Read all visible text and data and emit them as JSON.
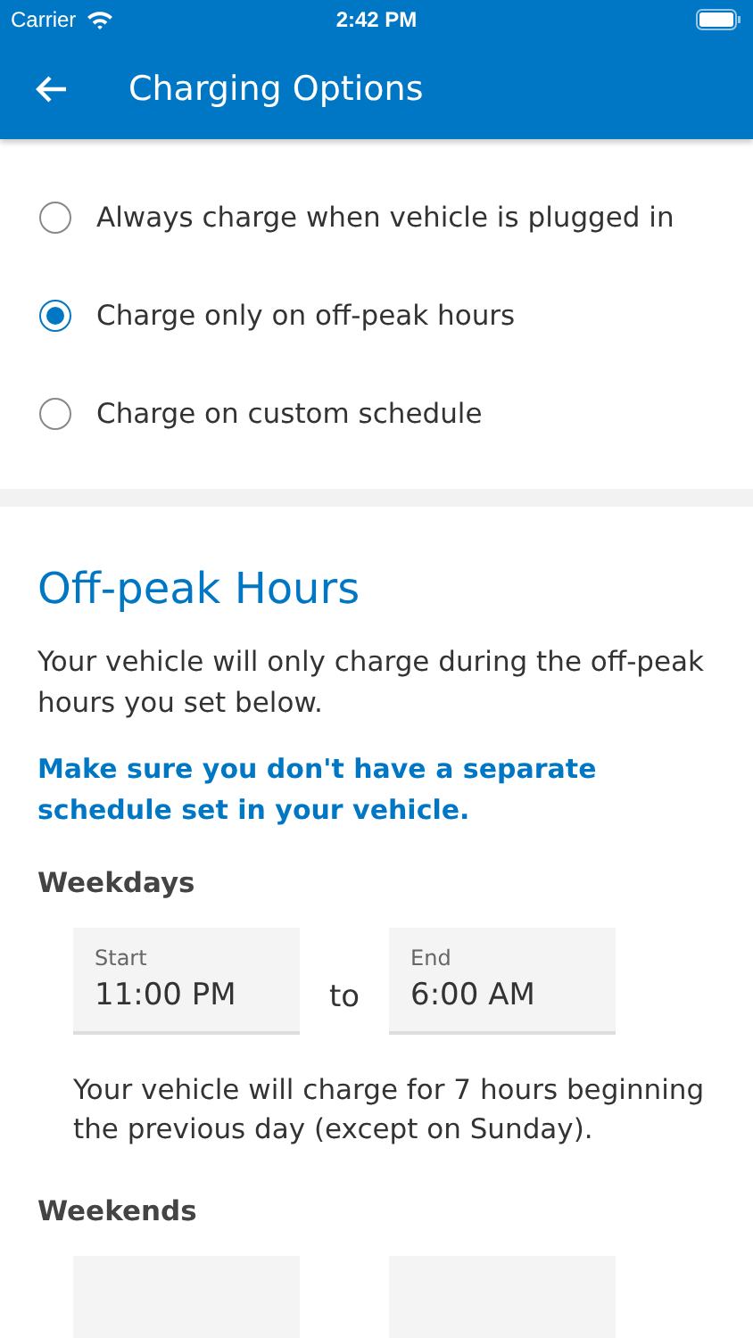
{
  "status_bar": {
    "carrier": "Carrier",
    "time": "2:42 PM"
  },
  "header": {
    "title": "Charging Options"
  },
  "options": [
    {
      "label": "Always charge when vehicle is plugged in",
      "selected": false
    },
    {
      "label": "Charge only on off-peak hours",
      "selected": true
    },
    {
      "label": "Charge on custom schedule",
      "selected": false
    }
  ],
  "off_peak": {
    "title": "Off-peak Hours",
    "description": "Your vehicle will only charge during the off-peak hours you set below.",
    "warning": "Make sure you don't have a separate schedule set in your vehicle.",
    "groups": [
      {
        "title": "Weekdays",
        "start_label": "Start",
        "start": "11:00 PM",
        "separator": "to",
        "end_label": "End",
        "end": "6:00 AM",
        "note": "Your vehicle will charge for 7 hours beginning the previous day (except on Sunday)."
      },
      {
        "title": "Weekends"
      }
    ]
  }
}
